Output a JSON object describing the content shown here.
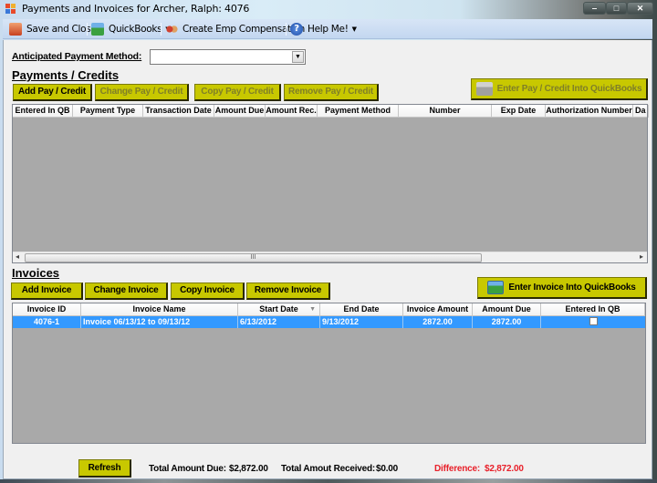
{
  "window": {
    "title": "Payments and Invoices for Archer, Ralph: 4076",
    "controls": {
      "minimize": "‒",
      "maximize": "□",
      "close": "✕"
    }
  },
  "toolbar": {
    "items": [
      {
        "label": "Save and Close",
        "icon": "save-close-icon"
      },
      {
        "label": "QuickBooks",
        "icon": "quickbooks-icon",
        "dropdown": true
      },
      {
        "label": "Create Emp Compensation",
        "icon": "people-icon"
      },
      {
        "label": "Help Me!",
        "icon": "help-icon",
        "dropdown": true
      }
    ],
    "caret": "▼"
  },
  "anticipated_payment": {
    "label": "Anticipated Payment Method:",
    "value": "",
    "caret": "▼"
  },
  "payments": {
    "heading": "Payments / Credits",
    "buttons": {
      "add": "Add Pay / Credit",
      "change": "Change Pay / Credit",
      "copy": "Copy Pay / Credit",
      "remove": "Remove Pay / Credit",
      "enter_qb": "Enter Pay / Credit Into QuickBooks"
    },
    "columns": [
      "Entered In QB",
      "Payment Type",
      "Transaction Date",
      "Amount Due",
      "Amount Rec.",
      "Payment Method",
      "Number",
      "Exp Date",
      "Authorization Number",
      "Da"
    ],
    "rows": [],
    "scrollbar": {
      "left_arrow": "◂",
      "right_arrow": "▸",
      "grip": "III"
    }
  },
  "invoices": {
    "heading": "Invoices",
    "buttons": {
      "add": "Add Invoice",
      "change": "Change Invoice",
      "copy": "Copy Invoice",
      "remove": "Remove Invoice",
      "enter_qb": "Enter Invoice Into QuickBooks"
    },
    "columns": [
      "Invoice ID",
      "Invoice Name",
      "Start Date",
      "End Date",
      "Invoice Amount",
      "Amount Due",
      "Entered In QB"
    ],
    "sort_indicator": "▼",
    "rows": [
      {
        "invoice_id": "4076-1",
        "invoice_name": "Invoice 06/13/12 to 09/13/12",
        "start_date": "6/13/2012",
        "end_date": "9/13/2012",
        "invoice_amount": "2872.00",
        "amount_due": "2872.00",
        "entered_in_qb": false,
        "selected": true
      }
    ]
  },
  "footer": {
    "refresh": "Refresh",
    "total_due_label": "Total Amount Due:",
    "total_due_value": "$2,872.00",
    "total_received_label": "Total Amout Received:",
    "total_received_value": "$0.00",
    "difference_label": "Difference:",
    "difference_value": "$2,872.00",
    "difference_color": "#e8202a"
  },
  "colors": {
    "button_yellow": "#c8c800",
    "grid_background": "#a9a9a9",
    "selection_blue": "#3399ff"
  }
}
